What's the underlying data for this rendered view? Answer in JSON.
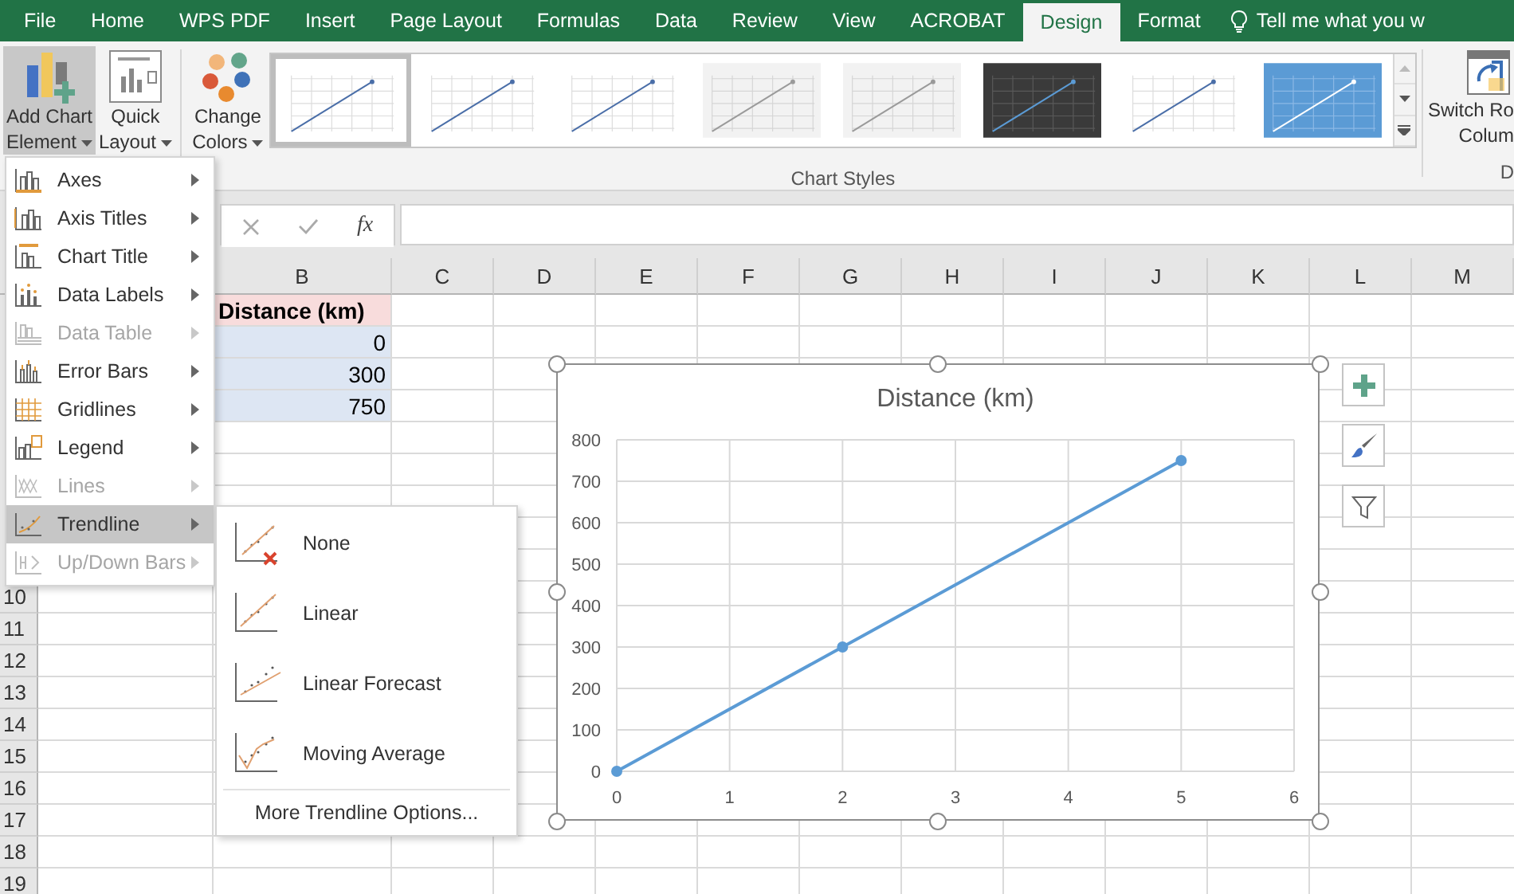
{
  "tabs": [
    {
      "label": "File",
      "selected": false
    },
    {
      "label": "Home",
      "selected": false
    },
    {
      "label": "WPS PDF",
      "selected": false
    },
    {
      "label": "Insert",
      "selected": false
    },
    {
      "label": "Page Layout",
      "selected": false
    },
    {
      "label": "Formulas",
      "selected": false
    },
    {
      "label": "Data",
      "selected": false
    },
    {
      "label": "Review",
      "selected": false
    },
    {
      "label": "View",
      "selected": false
    },
    {
      "label": "ACROBAT",
      "selected": false
    },
    {
      "label": "Design",
      "selected": true
    },
    {
      "label": "Format",
      "selected": false
    }
  ],
  "tell_me": "Tell me what you w",
  "ribbon": {
    "buttons": [
      {
        "kind": "add_chart",
        "label": "Add Chart Element",
        "active": true
      },
      {
        "kind": "quick_layout",
        "label": "Quick Layout",
        "active": false
      },
      {
        "kind": "change_colors",
        "label": "Change Colors",
        "active": false
      }
    ],
    "styles": [
      {
        "kind": "light",
        "selected": true
      },
      {
        "kind": "light",
        "selected": false
      },
      {
        "kind": "light",
        "selected": false
      },
      {
        "kind": "gray",
        "selected": false
      },
      {
        "kind": "gray",
        "selected": false
      },
      {
        "kind": "dark",
        "selected": false
      },
      {
        "kind": "light",
        "selected": false
      },
      {
        "kind": "blue",
        "selected": false
      }
    ],
    "styles_label": "Chart Styles",
    "switch_lines": [
      "Switch Ro",
      "Colum"
    ],
    "data_group_label": "D"
  },
  "formula_bar": {
    "function_label": "fx"
  },
  "sheet": {
    "columns": [
      "B",
      "C",
      "D",
      "E",
      "F",
      "G",
      "H",
      "I",
      "J",
      "K",
      "L",
      "M"
    ],
    "row_numbers": [
      "10",
      "11",
      "12",
      "13",
      "14",
      "15",
      "16",
      "17",
      "18",
      "19"
    ],
    "cells": [
      {
        "text": "Distance (km)",
        "kind": "header"
      },
      {
        "text": "0",
        "kind": "number"
      },
      {
        "text": "300",
        "kind": "number"
      },
      {
        "text": "750",
        "kind": "number"
      }
    ]
  },
  "chart": {
    "chart_data": {
      "type": "line",
      "title": "Distance (km)",
      "x": [
        0,
        2,
        5
      ],
      "grid": true,
      "series": [
        {
          "color": "#5b9bd5",
          "marker": "circle",
          "values": [
            0,
            300,
            750
          ]
        }
      ],
      "xlim": [
        0,
        6
      ],
      "ylim": [
        0,
        800
      ],
      "xticks": [
        0,
        1,
        2,
        3,
        4,
        5,
        6
      ],
      "yticks": [
        0,
        100,
        200,
        300,
        400,
        500,
        600,
        700,
        800
      ]
    }
  },
  "menu": {
    "items": [
      {
        "kind": "axes",
        "label": "Axes",
        "disabled": false,
        "selected": false
      },
      {
        "kind": "axis_titles",
        "label": "Axis Titles",
        "disabled": false,
        "selected": false
      },
      {
        "kind": "chart_title",
        "label": "Chart Title",
        "disabled": false,
        "selected": false
      },
      {
        "kind": "data_labels",
        "label": "Data Labels",
        "disabled": false,
        "selected": false
      },
      {
        "kind": "data_table",
        "label": "Data Table",
        "disabled": true,
        "selected": false
      },
      {
        "kind": "error_bars",
        "label": "Error Bars",
        "disabled": false,
        "selected": false
      },
      {
        "kind": "gridlines",
        "label": "Gridlines",
        "disabled": false,
        "selected": false
      },
      {
        "kind": "legend",
        "label": "Legend",
        "disabled": false,
        "selected": false
      },
      {
        "kind": "lines",
        "label": "Lines",
        "disabled": true,
        "selected": false
      },
      {
        "kind": "trendline",
        "label": "Trendline",
        "disabled": false,
        "selected": true
      },
      {
        "kind": "updown",
        "label": "Up/Down Bars",
        "disabled": true,
        "selected": false
      }
    ]
  },
  "submenu": {
    "items": [
      {
        "kind": "none",
        "label": "None"
      },
      {
        "kind": "linear",
        "label": "Linear"
      },
      {
        "kind": "forecast",
        "label": "Linear Forecast"
      },
      {
        "kind": "moving_average",
        "label": "Moving Average"
      }
    ],
    "more": "More Trendline Options..."
  }
}
